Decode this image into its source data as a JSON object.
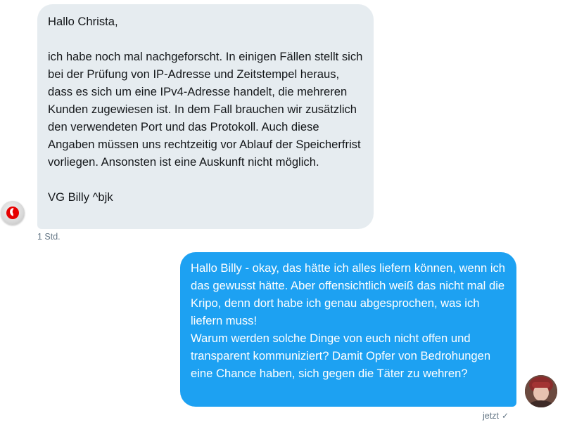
{
  "messages": {
    "incoming": {
      "text": "Hallo Christa,\n\nich habe noch mal nachgeforscht. In einigen Fällen stellt sich bei der Prüfung von IP-Adresse und Zeitstempel heraus, dass es sich um eine IPv4-Adresse handelt, die mehreren Kunden zugewiesen ist. In dem Fall brauchen wir zusätzlich den verwendeten Port und das Protokoll. Auch diese Angaben müssen uns rechtzeitig vor Ablauf der Speicherfrist vorliegen. Ansonsten ist eine Auskunft nicht möglich.\n\nVG Billy ^bjk",
      "timestamp": "1 Std.",
      "avatar_icon": "vodafone-logo-icon",
      "bubble_color": "#e6ecf0"
    },
    "outgoing": {
      "text": "Hallo Billy - okay, das hätte ich alles liefern können, wenn ich das gewusst hätte. Aber offensichtlich weiß das nicht mal die Kripo, denn dort habe ich genau abgesprochen, was ich liefern muss!\nWarum werden solche Dinge von euch nicht offen und transparent kommuniziert? Damit Opfer von Bedrohungen eine Chance haben, sich gegen die Täter zu wehren?",
      "timestamp": "jetzt",
      "read_mark": "✓",
      "avatar_icon": "user-avatar-icon",
      "bubble_color": "#1da1f2"
    }
  }
}
